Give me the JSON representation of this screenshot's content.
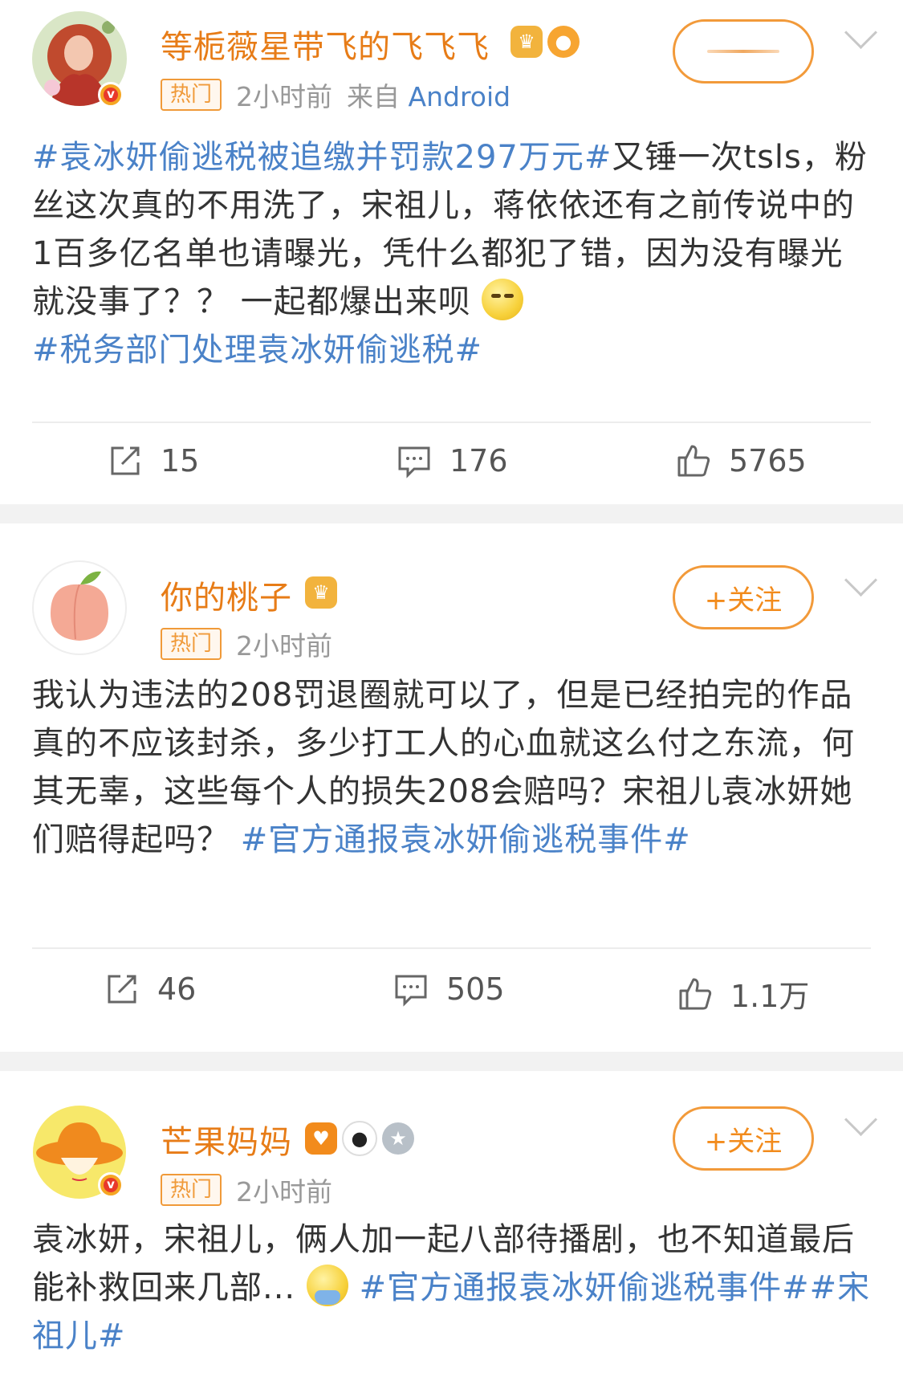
{
  "posts": [
    {
      "username": "等栀薇星带飞的飞飞飞",
      "hot_label": "热门",
      "time": "2小时前",
      "source_prefix": "来自",
      "source": "Android",
      "verified_mark": "v",
      "follow_label": "",
      "text": {
        "topic1": "#袁冰妍偷逃税被追缴并罚款297万元#",
        "line1_rest": "又锤一次",
        "body": "tsls，粉丝这次真的不用洗了，宋祖儿，蒋依依还有之前传说中的1百多亿名单也请曝光，凭什么都犯了错，因为没有曝光就没事了？？ 一起都爆出来呗 ",
        "topic2": "#税务部门处理袁冰妍偷逃税#"
      },
      "repost_count": "15",
      "comment_count": "176",
      "like_count": "5765"
    },
    {
      "username": "你的桃子",
      "hot_label": "热门",
      "time": "2小时前",
      "follow_label": "+关注",
      "text": {
        "body": "我认为违法的208罚退圈就可以了，但是已经拍完的作品真的不应该封杀，多少打工人的心血就这么付之东流，何其无辜，这些每个人的损失208会赔吗？宋祖儿袁冰妍她们赔得起吗？ ",
        "topic1": "#官方通报袁冰妍偷逃税事件#"
      },
      "repost_count": "46",
      "comment_count": "505",
      "like_count": "1.1万"
    },
    {
      "username": "芒果妈妈",
      "hot_label": "热门",
      "time": "2小时前",
      "verified_mark": "v",
      "follow_label": "+关注",
      "text": {
        "body": "袁冰妍，宋祖儿，俩人加一起八部待播剧，也不知道最后能补救回来几部... ",
        "topic1": "#官方通报袁冰妍偷逃税事件#",
        "topic2": "#宋祖儿#"
      }
    }
  ],
  "colors": {
    "username": "#e77c17",
    "topic": "#4a82c8",
    "follow_border": "#f29a3a",
    "separator": "#f2f2f2"
  },
  "icons": {
    "repost": "repost-icon",
    "comment": "comment-icon",
    "like": "like-icon",
    "more": "chevron-down-icon"
  }
}
